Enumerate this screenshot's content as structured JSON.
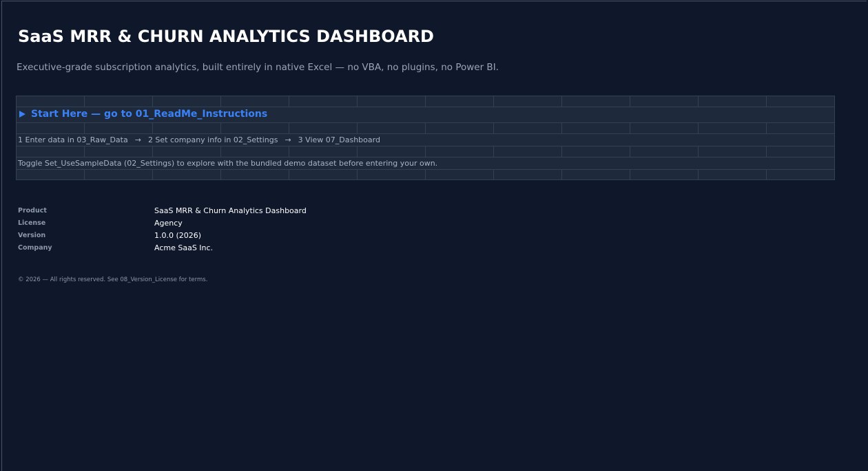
{
  "header": {
    "title": "SaaS MRR & CHURN ANALYTICS DASHBOARD",
    "subtitle": "Executive-grade subscription analytics, built entirely in native Excel — no VBA, no plugins, no Power BI."
  },
  "callout": {
    "start_link": "Start Here — go to 01_ReadMe_Instructions",
    "steps": [
      "1  Enter data in 03_Raw_Data",
      "2  Set company info in 02_Settings",
      "3  View 07_Dashboard"
    ],
    "arrow": "→",
    "toggle_note": "Toggle Set_UseSampleData (02_Settings) to explore with the bundled demo dataset before entering your own."
  },
  "info": {
    "rows": [
      {
        "label": "Product",
        "value": "SaaS MRR & Churn Analytics Dashboard"
      },
      {
        "label": "License",
        "value": "Agency"
      },
      {
        "label": "Version",
        "value": "1.0.0 (2026)"
      },
      {
        "label": "Company",
        "value": "Acme SaaS Inc."
      }
    ]
  },
  "footer": {
    "text": "© 2026 — All rights reserved. See 08_Version_License for terms."
  },
  "colors": {
    "background": "#0f172a",
    "panel": "#1e293b",
    "accent": "#3b82f6"
  },
  "icons": {
    "start": "play-icon"
  }
}
